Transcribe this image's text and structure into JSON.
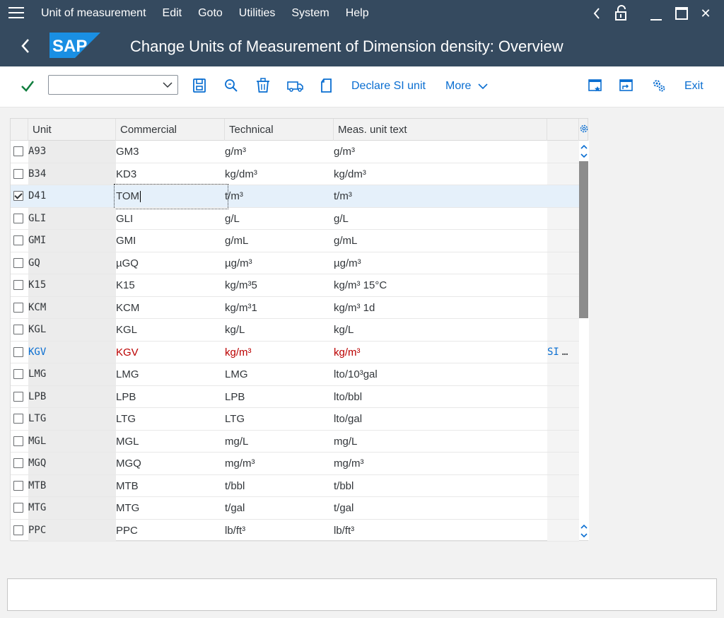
{
  "menu": {
    "items": [
      "Unit of measurement",
      "Edit",
      "Goto",
      "Utilities",
      "System",
      "Help"
    ]
  },
  "window_controls": {
    "minimize": "—",
    "close": "✕"
  },
  "header": {
    "logo_text": "SAP",
    "title": "Change Units of Measurement of Dimension density: Overview"
  },
  "toolbar": {
    "command_value": "",
    "declare_si_unit": "Declare SI unit",
    "more": "More",
    "exit": "Exit"
  },
  "table": {
    "columns": [
      "Unit",
      "Commercial",
      "Technical",
      "Meas. unit text"
    ],
    "rows": [
      {
        "unit": "A93",
        "commercial": "GM3",
        "technical": "g/m³",
        "text": "g/m³",
        "extra": "",
        "checked": false
      },
      {
        "unit": "B34",
        "commercial": "KD3",
        "technical": "kg/dm³",
        "text": "kg/dm³",
        "extra": "",
        "checked": false
      },
      {
        "unit": "D41",
        "commercial": "TOM",
        "technical": "t/m³",
        "text": "t/m³",
        "extra": "",
        "checked": true
      },
      {
        "unit": "GLI",
        "commercial": "GLI",
        "technical": "g/L",
        "text": "g/L",
        "extra": "",
        "checked": false
      },
      {
        "unit": "GMI",
        "commercial": "GMI",
        "technical": "g/mL",
        "text": "g/mL",
        "extra": "",
        "checked": false
      },
      {
        "unit": "GQ",
        "commercial": "µGQ",
        "technical": "µg/m³",
        "text": "µg/m³",
        "extra": "",
        "checked": false
      },
      {
        "unit": "K15",
        "commercial": "K15",
        "technical": "kg/m³5",
        "text": "kg/m³ 15°C",
        "extra": "",
        "checked": false
      },
      {
        "unit": "KCM",
        "commercial": "KCM",
        "technical": "kg/m³1",
        "text": "kg/m³ 1d",
        "extra": "",
        "checked": false
      },
      {
        "unit": "KGL",
        "commercial": "KGL",
        "technical": "kg/L",
        "text": "kg/L",
        "extra": "",
        "checked": false
      },
      {
        "unit": "KGV",
        "commercial": "KGV",
        "technical": "kg/m³",
        "text": "kg/m³",
        "extra": "SI",
        "extra_more": "…",
        "checked": false
      },
      {
        "unit": "LMG",
        "commercial": "LMG",
        "technical": "LMG",
        "text": "lto/10³gal",
        "extra": "",
        "checked": false
      },
      {
        "unit": "LPB",
        "commercial": "LPB",
        "technical": "LPB",
        "text": "lto/bbl",
        "extra": "",
        "checked": false
      },
      {
        "unit": "LTG",
        "commercial": "LTG",
        "technical": "LTG",
        "text": "lto/gal",
        "extra": "",
        "checked": false
      },
      {
        "unit": "MGL",
        "commercial": "MGL",
        "technical": "mg/L",
        "text": "mg/L",
        "extra": "",
        "checked": false
      },
      {
        "unit": "MGQ",
        "commercial": "MGQ",
        "technical": "mg/m³",
        "text": "mg/m³",
        "extra": "",
        "checked": false
      },
      {
        "unit": "MTB",
        "commercial": "MTB",
        "technical": "t/bbl",
        "text": "t/bbl",
        "extra": "",
        "checked": false
      },
      {
        "unit": "MTG",
        "commercial": "MTG",
        "technical": "t/gal",
        "text": "t/gal",
        "extra": "",
        "checked": false
      },
      {
        "unit": "PPC",
        "commercial": "PPC",
        "technical": "lb/ft³",
        "text": "lb/ft³",
        "extra": "",
        "checked": false
      }
    ]
  },
  "selected_row": 2,
  "highlighted_row": 9,
  "statusbar": {
    "message": ""
  },
  "colors": {
    "shell": "#354a5f",
    "accent": "#0a6ed1",
    "highlight_text": "#bb0000",
    "save_check": "#107e3e",
    "logo_blue": "#0a6ed1"
  }
}
